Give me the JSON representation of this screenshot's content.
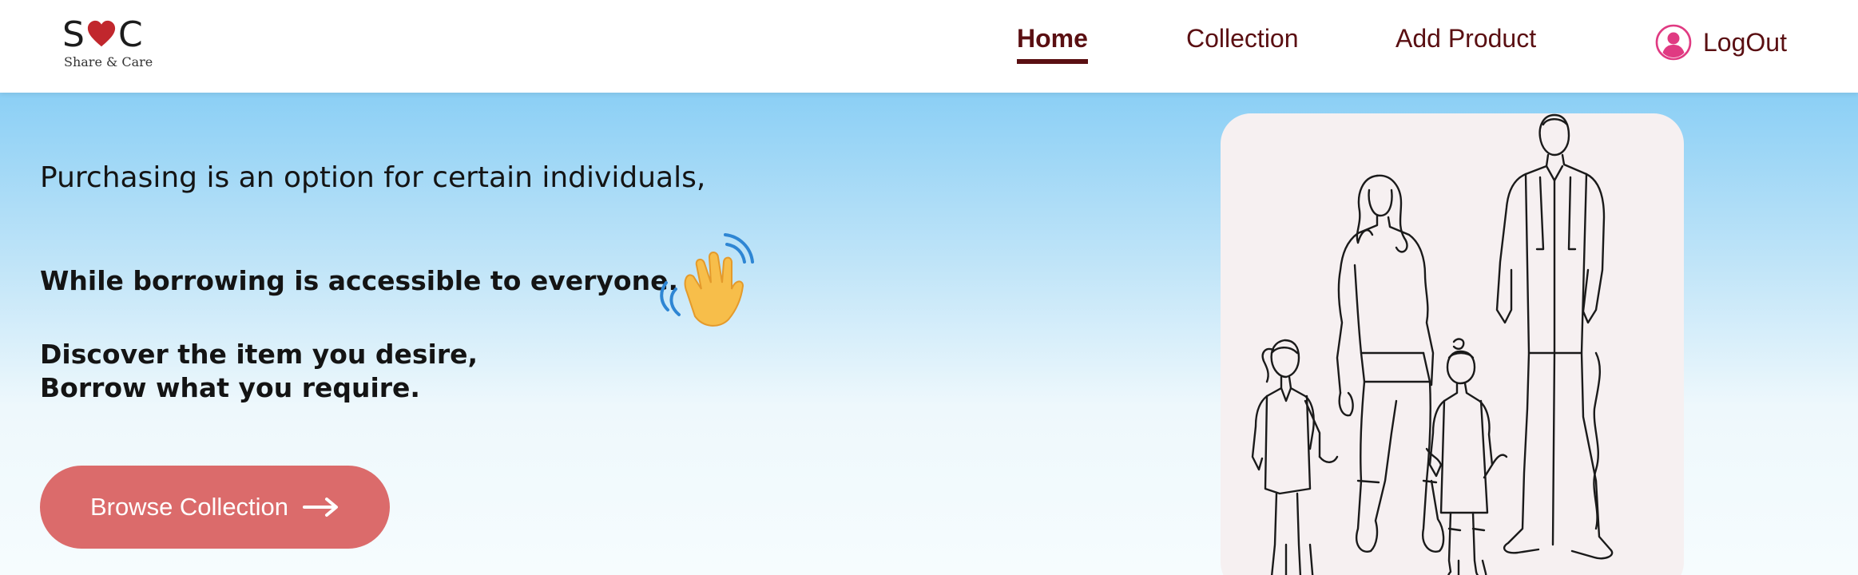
{
  "brand": {
    "logo_left": "S",
    "logo_right": "C",
    "tagline": "Share & Care",
    "heart_color": "#c1272d"
  },
  "nav": {
    "home": "Home",
    "collection": "Collection",
    "add_product": "Add Product",
    "logout": "LogOut",
    "active": "Home"
  },
  "hero": {
    "line1": "Purchasing is an option for certain individuals,",
    "line2": "While borrowing is accessible to everyone.",
    "line3": "Discover the item you desire,",
    "line4": "Borrow what you require.",
    "wave_emoji": "waving-hand-icon",
    "cta": "Browse Collection"
  },
  "colors": {
    "accent": "#5a0f12",
    "button": "#db6b6b",
    "user_icon": "#e03a82"
  }
}
